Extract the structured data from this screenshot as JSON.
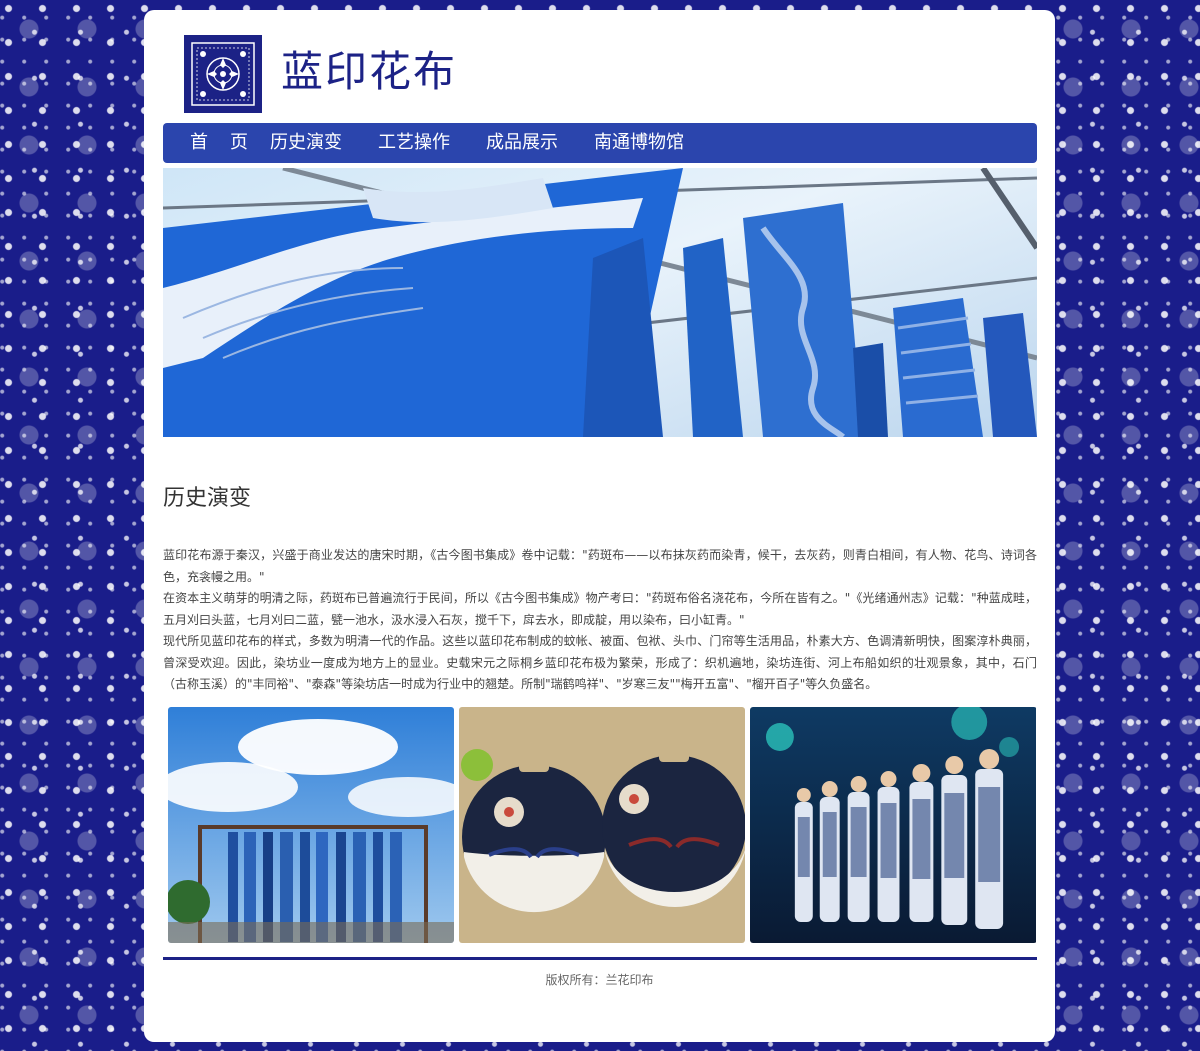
{
  "site": {
    "title": "蓝印花布"
  },
  "nav": {
    "items": [
      {
        "label": "首页"
      },
      {
        "label": "历史演变"
      },
      {
        "label": "工艺操作"
      },
      {
        "label": "成品展示"
      },
      {
        "label": "南通博物馆"
      }
    ]
  },
  "main": {
    "section_title": "历史演变",
    "paragraphs": [
      "蓝印花布源于秦汉，兴盛于商业发达的唐宋时期，《古今图书集成》卷中记载：\"药斑布——以布抹灰药而染青，候干，去灰药，则青白相间，有人物、花鸟、诗词各色，充衾幔之用。\"",
      "在资本主义萌芽的明清之际，药斑布已普遍流行于民间，所以《古今图书集成》物产考曰：\"药斑布俗名浇花布，今所在皆有之。\"《光绪通州志》记载：\"种蓝成畦，五月刈曰头蓝，七月刈曰二蓝，甓一池水，汲水浸入石灰，搅千下，戽去水，即成靛，用以染布，曰小缸青。\"",
      "现代所见蓝印花布的样式，多数为明清一代的作品。这些以蓝印花布制成的蚊帐、被面、包袱、头巾、门帘等生活用品，朴素大方、色调清新明快，图案淳朴典丽，曾深受欢迎。因此，染坊业一度成为地方上的显业。史载宋元之际桐乡蓝印花布极为繁荣，形成了：织机遍地，染坊连街、河上布船如织的壮观景象，其中，石门（古称玉溪）的\"丰同裕\"、\"泰森\"等染坊店一时成为行业中的翘楚。所制\"瑞鹤鸣祥\"、\"岁寒三友\"\"梅开五富\"、\"榴开百子\"等久负盛名。"
    ]
  },
  "footer": {
    "copyright": "版权所有：兰花印布"
  },
  "colors": {
    "brand_blue": "#1c2286",
    "nav_blue": "#2b45ad",
    "background_indigo": "#1a1d8a"
  }
}
